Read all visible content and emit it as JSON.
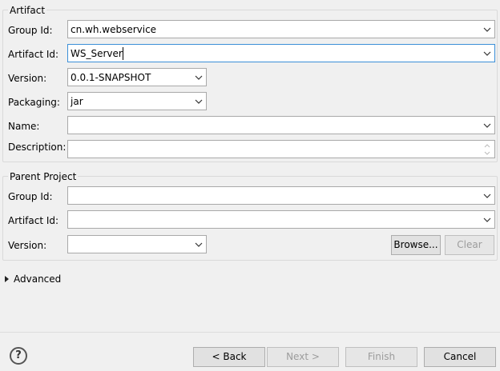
{
  "artifact": {
    "title": "Artifact",
    "group_id": {
      "label": "Group Id:",
      "value": "cn.wh.webservice"
    },
    "artifact_id": {
      "label": "Artifact Id:",
      "value": "WS_Server"
    },
    "version": {
      "label": "Version:",
      "value": "0.0.1-SNAPSHOT"
    },
    "packaging": {
      "label": "Packaging:",
      "value": "jar"
    },
    "name": {
      "label": "Name:",
      "value": ""
    },
    "description": {
      "label": "Description:",
      "value": ""
    }
  },
  "parent": {
    "title": "Parent Project",
    "group_id": {
      "label": "Group Id:",
      "value": ""
    },
    "artifact_id": {
      "label": "Artifact Id:",
      "value": ""
    },
    "version": {
      "label": "Version:",
      "value": ""
    },
    "browse_label": "Browse...",
    "clear_label": "Clear"
  },
  "advanced": {
    "label": "Advanced"
  },
  "footer": {
    "help_glyph": "?",
    "back_label": "< Back",
    "next_label": "Next >",
    "finish_label": "Finish",
    "cancel_label": "Cancel"
  },
  "icons": {
    "dropdown": "chevron-down-icon",
    "help": "help-icon",
    "expand": "triangle-right-icon"
  },
  "colors": {
    "background": "#f0f0f0",
    "focus_border": "#3b8fd8",
    "disabled_text": "#9c9c9c"
  }
}
